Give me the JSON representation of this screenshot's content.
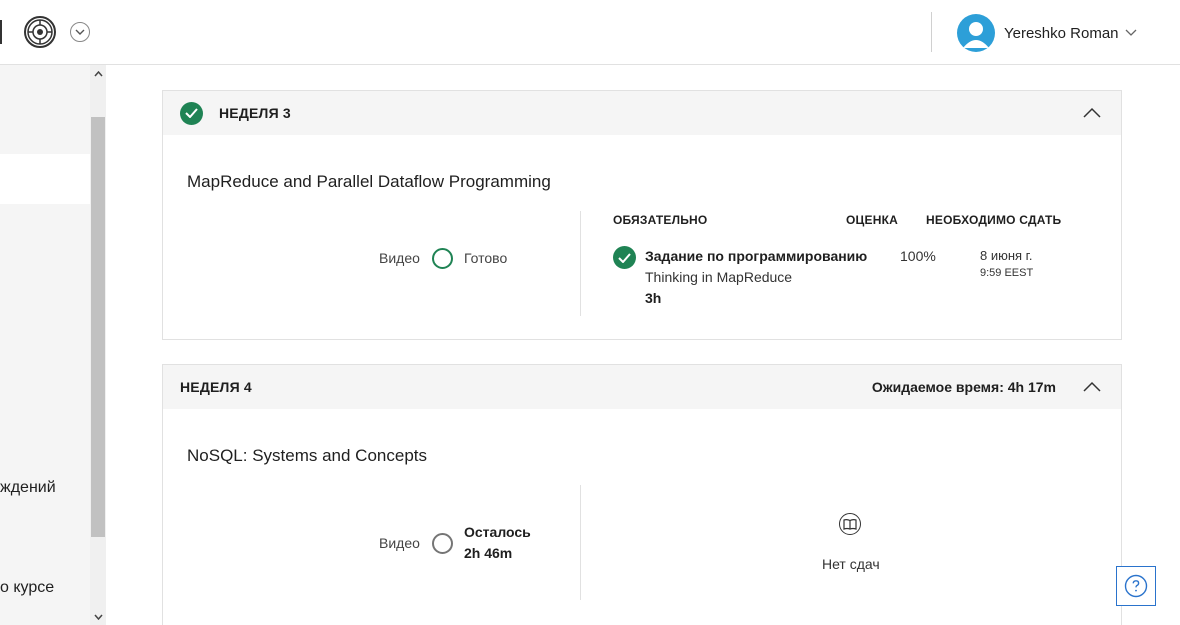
{
  "header": {
    "user_name": "Yereshko Roman"
  },
  "sidebar": {
    "partial_items": [
      {
        "label": "ждений"
      },
      {
        "label": "о курсе"
      }
    ]
  },
  "weeks": [
    {
      "title": "НЕДЕЛЯ 3",
      "completed": true,
      "lesson_title": "MapReduce and Parallel Dataflow Programming",
      "video_label": "Видео",
      "video_status": "Готово",
      "columns": {
        "required": "ОБЯЗАТЕЛЬНО",
        "grade": "ОЦЕНКА",
        "due": "НЕОБХОДИМО СДАТЬ"
      },
      "assignment": {
        "type": "Задание по программированию",
        "name": "Thinking in MapReduce",
        "duration": "3h",
        "grade": "100%",
        "due_date": "8 июня г.",
        "due_time": "9:59 EEST"
      }
    },
    {
      "title": "НЕДЕЛЯ 4",
      "completed": false,
      "expected_time": "Ожидаемое время: 4h 17m",
      "lesson_title": "NoSQL: Systems and Concepts",
      "video_label": "Видео",
      "video_status_line1": "Осталось",
      "video_status_line2": "2h 46m",
      "no_submissions": "Нет сдач"
    }
  ],
  "colors": {
    "success_green": "#1f8354",
    "avatar_blue": "#2d9fd8",
    "help_blue": "#2a73cc"
  }
}
